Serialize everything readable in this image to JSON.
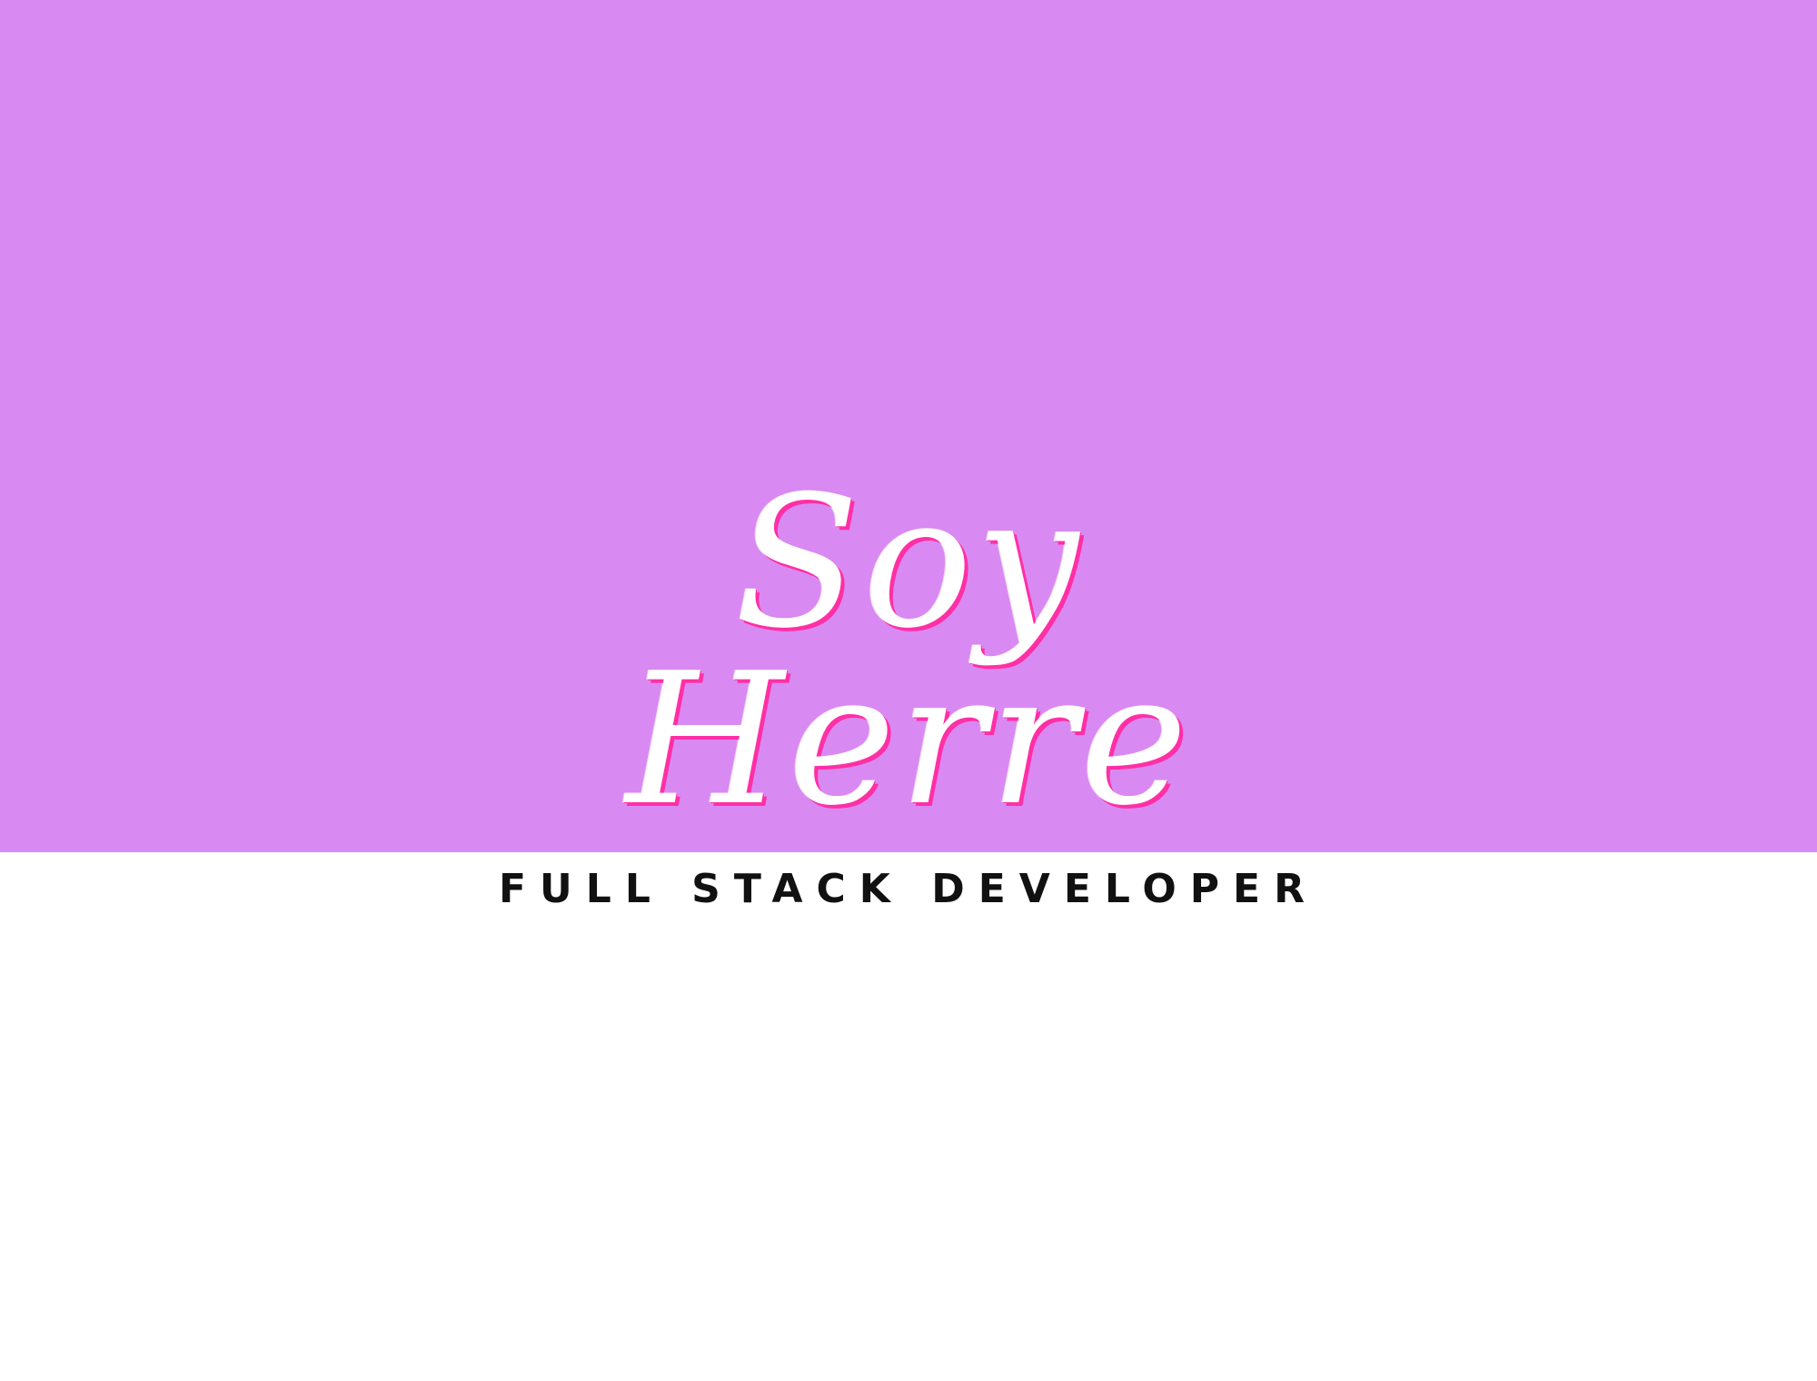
{
  "hero": {
    "background_color": "#d989f2",
    "name_line_1": "Soy",
    "name_line_2": "Herre",
    "name_text_color": "#ffffff",
    "name_shadow_color": "#ff2fa6"
  },
  "tagline": {
    "text": "FULL STACK DEVELOPER",
    "color": "#111111"
  },
  "page": {
    "background_color": "#ffffff"
  }
}
